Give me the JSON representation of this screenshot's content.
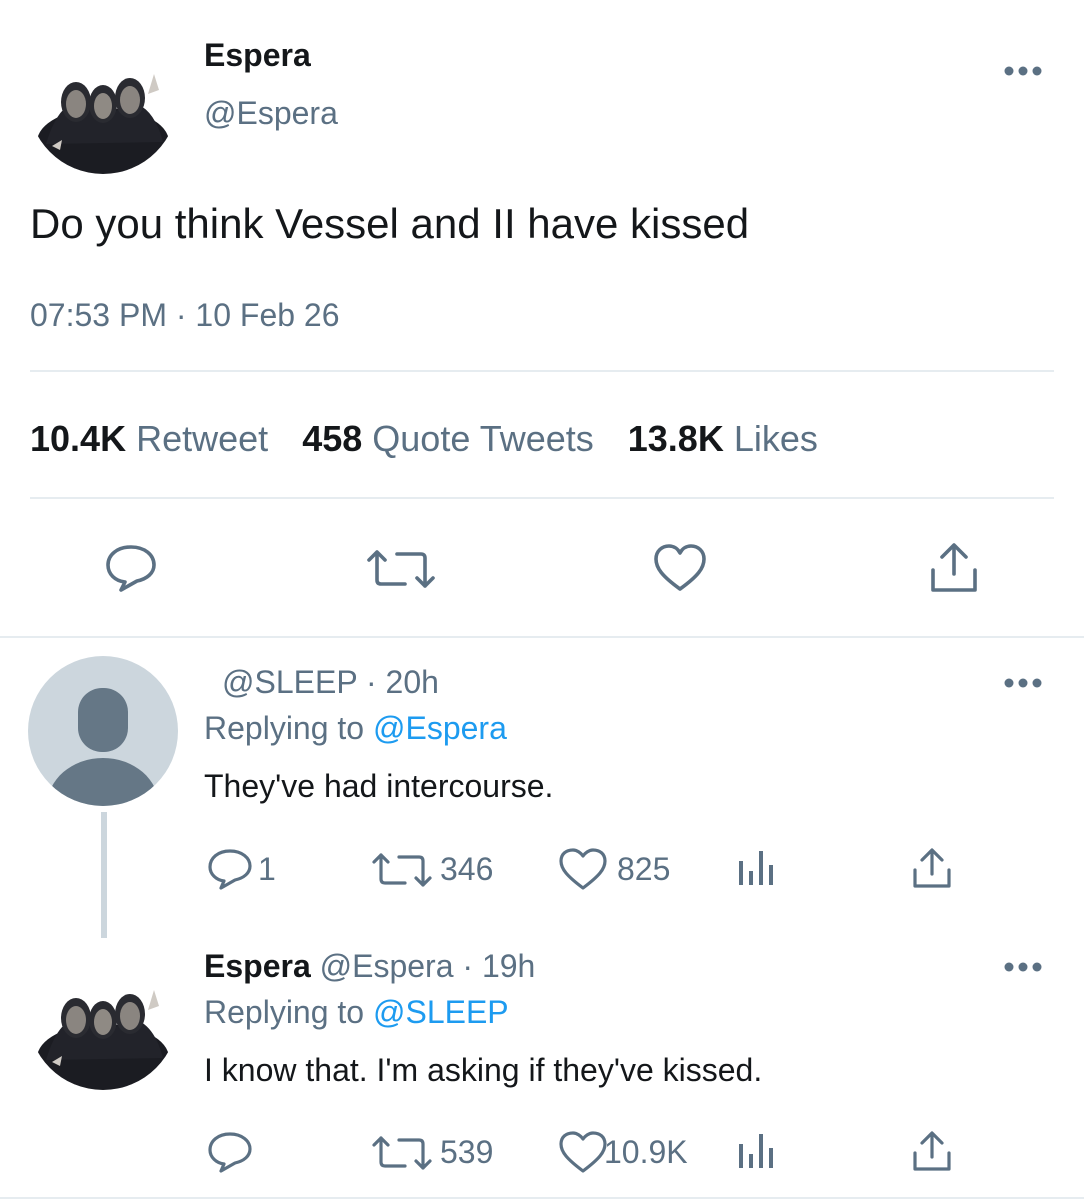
{
  "main_tweet": {
    "author_name": "Espera",
    "author_handle": "@Espera",
    "text": "Do you think Vessel and II have kissed",
    "timestamp": "07:53 PM · 10 Feb 26",
    "stats": {
      "retweets_count": "10.4K",
      "retweets_label": "Retweet",
      "quotes_count": "458",
      "quotes_label": "Quote Tweets",
      "likes_count": "13.8K",
      "likes_label": "Likes"
    },
    "actions": [
      "reply-icon",
      "retweet-icon",
      "like-icon",
      "share-icon"
    ]
  },
  "replies": [
    {
      "author_name": "",
      "author_handle": "@SLEEP",
      "time": "20h",
      "header": "@SLEEP · 20h",
      "replying_prefix": "Replying to",
      "replying_to": "@Espera",
      "text": "They've had intercourse.",
      "counts": {
        "replies": "1",
        "retweets": "346",
        "likes": "825"
      }
    },
    {
      "author_name": "Espera",
      "author_handle_time": "@Espera · 19h",
      "replying_prefix": "Replying to",
      "replying_to": "@SLEEP",
      "text": "I know that. I'm asking if they've kissed.",
      "counts": {
        "replies": "",
        "retweets": "539",
        "likes": "10.9K"
      }
    }
  ],
  "colors": {
    "accent": "#1d9bf0",
    "secondary_text": "#5b7083",
    "divider": "#e6ecf0",
    "default_avatar_bg": "#ccd6dd",
    "default_avatar_fg": "#657786"
  }
}
